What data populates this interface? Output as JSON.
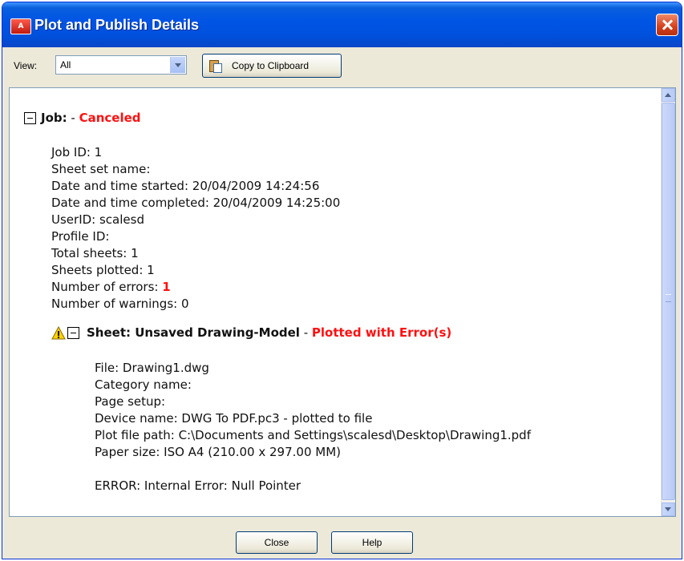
{
  "window": {
    "title": "Plot and Publish Details",
    "title_icon_text": "A"
  },
  "toolbar": {
    "view_label": "View:",
    "view_value": "All",
    "copy_label": "Copy to Clipboard"
  },
  "job": {
    "heading": "Job:",
    "separator": " - ",
    "status": "Canceled",
    "details": [
      "Job ID: 1",
      "Sheet set name:",
      "Date and time started: 20/04/2009 14:24:56",
      "Date and time completed: 20/04/2009 14:25:00",
      "UserID: scalesd",
      "Profile ID:",
      "Total sheets: 1",
      "Sheets plotted: 1"
    ],
    "errors_label": "Number of errors: ",
    "errors_value": "1",
    "warnings": "Number of warnings: 0"
  },
  "sheet": {
    "heading": "Sheet: Unsaved Drawing-Model",
    "separator": " - ",
    "status": "Plotted with Error(s)",
    "details": [
      "File: Drawing1.dwg",
      "Category name:",
      "Page setup:",
      "Device name: DWG To PDF.pc3 - plotted to file",
      "Plot file path: C:\\Documents and Settings\\scalesd\\Desktop\\Drawing1.pdf",
      "Paper size: ISO A4 (210.00 x 297.00 MM)"
    ],
    "error": "ERROR: Internal Error: Null Pointer"
  },
  "buttons": {
    "close": "Close",
    "help": "Help"
  },
  "colors": {
    "title_blue": "#0055e5",
    "error_red": "#ff1010",
    "dialog_bg": "#ece9d8"
  }
}
